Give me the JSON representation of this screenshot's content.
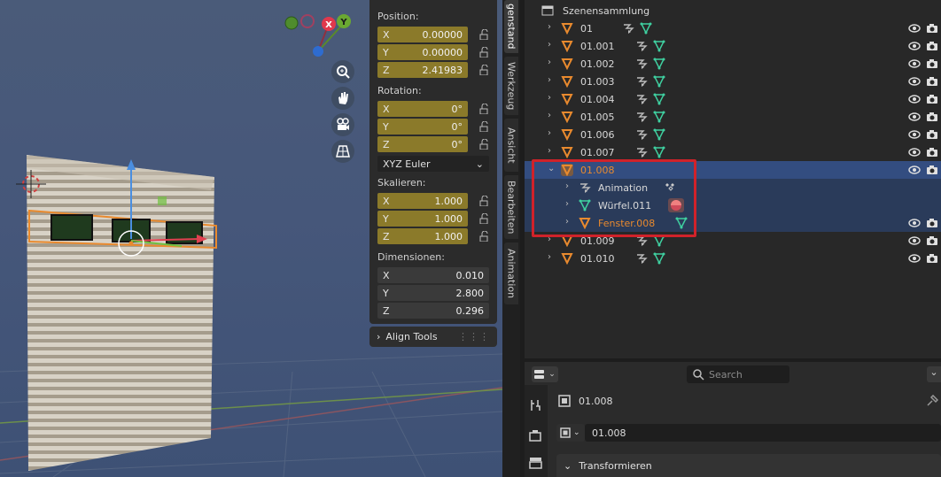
{
  "n_panel": {
    "position_label": "Position:",
    "position": [
      {
        "axis": "X",
        "value": "0.00000"
      },
      {
        "axis": "Y",
        "value": "0.00000"
      },
      {
        "axis": "Z",
        "value": "2.41983"
      }
    ],
    "rotation_label": "Rotation:",
    "rotation": [
      {
        "axis": "X",
        "value": "0°"
      },
      {
        "axis": "Y",
        "value": "0°"
      },
      {
        "axis": "Z",
        "value": "0°"
      }
    ],
    "rotation_mode": "XYZ Euler",
    "scale_label": "Skalieren:",
    "scale": [
      {
        "axis": "X",
        "value": "1.000"
      },
      {
        "axis": "Y",
        "value": "1.000"
      },
      {
        "axis": "Z",
        "value": "1.000"
      }
    ],
    "dimensions_label": "Dimensionen:",
    "dimensions": [
      {
        "axis": "X",
        "value": "0.010"
      },
      {
        "axis": "Y",
        "value": "2.800"
      },
      {
        "axis": "Z",
        "value": "0.296"
      }
    ],
    "align_tools": "Align Tools"
  },
  "gizmo": {
    "x": "X",
    "y": "Y"
  },
  "vertical_tabs": [
    "genstand",
    "Werkzeug",
    "Ansicht",
    "Bearbeiten",
    "Animation"
  ],
  "outliner": {
    "collection": "Szenensammlung",
    "rows": [
      {
        "label": "01"
      },
      {
        "label": "01.001"
      },
      {
        "label": "01.002"
      },
      {
        "label": "01.003"
      },
      {
        "label": "01.004"
      },
      {
        "label": "01.005"
      },
      {
        "label": "01.006"
      },
      {
        "label": "01.007"
      },
      {
        "label": "01.008"
      },
      {
        "label": "Animation"
      },
      {
        "label": "Würfel.011"
      },
      {
        "label": "Fenster.008"
      },
      {
        "label": "01.009"
      },
      {
        "label": "01.010"
      }
    ]
  },
  "properties": {
    "search_placeholder": "Search",
    "object_name": "01.008",
    "data_name": "01.008",
    "transform_panel": "Transformieren"
  },
  "colors": {
    "accent_field": "#8b7a2a",
    "selection": "#334d80",
    "highlight": "#d0222a",
    "object_orange": "#e98a2e",
    "mesh_green": "#3fd0a0"
  }
}
